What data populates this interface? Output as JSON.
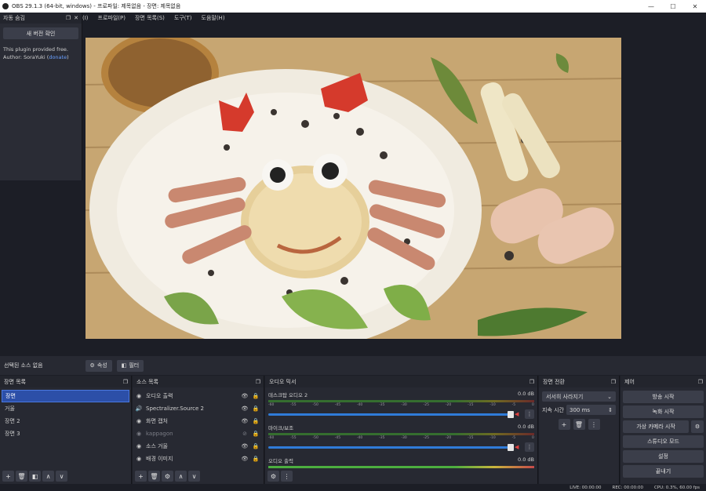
{
  "window": {
    "title": "OBS 29.1.3 (64-bit, windows) - 프로파일: 제목없음 - 장면: 제목없음",
    "minimize": "—",
    "maximize": "☐",
    "close": "✕"
  },
  "menu": [
    "(I)",
    "프로파일(P)",
    "장면 목록(S)",
    "도구(T)",
    "도움말(H)"
  ],
  "plugin_dock": {
    "title": "자동 숨김",
    "button": "새 버전 확인",
    "text_line1": "This plugin provided free.",
    "author_label": "Author: SoraYuki (",
    "donate": "donate",
    "author_end": ")"
  },
  "sources_bar": {
    "label": "선택된 소스 없음",
    "properties": "속성",
    "filters": "필터"
  },
  "scenes_panel": {
    "title": "장면 목록",
    "items": [
      "장면",
      "거울",
      "장면 2",
      "장면 3"
    ],
    "active_index": 0
  },
  "sources_panel": {
    "title": "소스 목록",
    "items": [
      {
        "icon": "◉",
        "label": "오디오 출력"
      },
      {
        "icon": "🔊",
        "label": "Spectralizer.Source 2"
      },
      {
        "icon": "◉",
        "label": "화면 캡처"
      },
      {
        "icon": "◉",
        "label": "kappagon"
      },
      {
        "icon": "◉",
        "label": "소스 거울"
      },
      {
        "icon": "◉",
        "label": "배경 이미지"
      }
    ]
  },
  "mixer_panel": {
    "title": "오디오 믹서",
    "tracks": [
      {
        "name": "데스크탑 오디오 2",
        "db": "0.0 dB"
      },
      {
        "name": "마이크/보조",
        "db": "0.0 dB"
      },
      {
        "name": "오디오 출력",
        "db": "0.0 dB"
      }
    ],
    "scale": [
      "-60",
      "-55",
      "-50",
      "-45",
      "-40",
      "-35",
      "-30",
      "-25",
      "-20",
      "-15",
      "-10",
      "-5",
      "0"
    ]
  },
  "transitions_panel": {
    "title": "장면 전환",
    "selected": "서서히 사라지기",
    "duration_label": "지속 시간",
    "duration_value": "300 ms"
  },
  "controls_panel": {
    "title": "제어",
    "start_stream": "방송 시작",
    "start_record": "녹화 시작",
    "virtual_cam": "가상 카메라 시작",
    "studio_mode": "스튜디오 모드",
    "settings": "설정",
    "exit": "끝내기"
  },
  "status": {
    "live": "LIVE: 00:00:00",
    "rec": "REC: 00:00:00",
    "cpu": "CPU: 0.3%, 60.00 fps"
  },
  "colors": {
    "background": "#1c1e26",
    "panel": "#272932",
    "accent": "#2c4fa8"
  }
}
